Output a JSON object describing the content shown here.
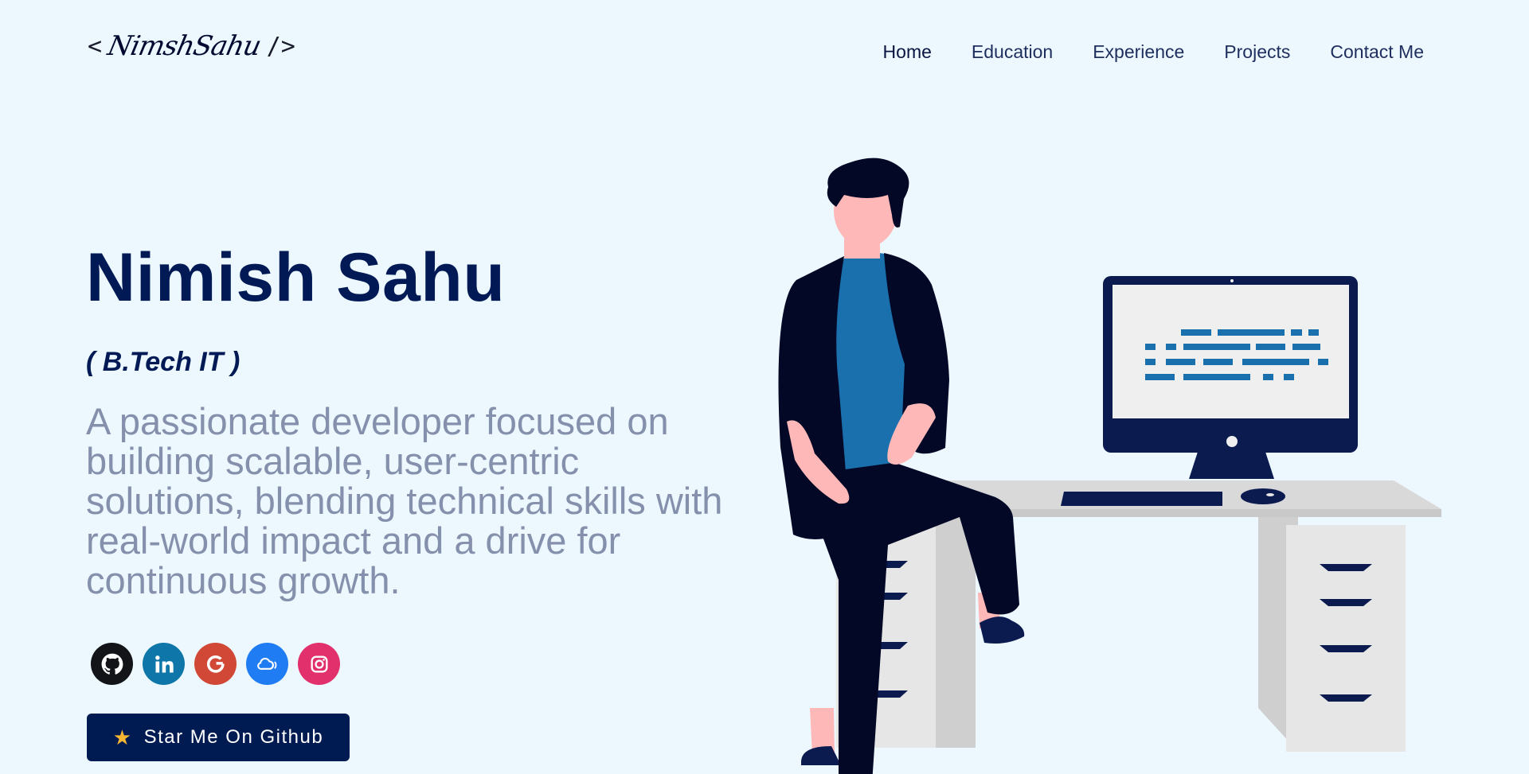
{
  "header": {
    "logo": {
      "open_bracket": "<",
      "signature": "NimshSahu",
      "close_bracket": "/>"
    },
    "nav": [
      {
        "label": "Home",
        "active": true
      },
      {
        "label": "Education"
      },
      {
        "label": "Experience"
      },
      {
        "label": "Projects"
      },
      {
        "label": "Contact Me"
      }
    ]
  },
  "hero": {
    "name": "Nimish Sahu",
    "degree": "( B.Tech IT )",
    "description": "A passionate developer focused on building scalable, user-centric solutions, blending technical skills with real-world impact and a drive for continuous growth.",
    "socials": [
      {
        "icon": "github-icon",
        "color": "#131418"
      },
      {
        "icon": "linkedin-icon",
        "color": "#0e76a8"
      },
      {
        "icon": "google-icon",
        "color": "#d14836"
      },
      {
        "icon": "cloud-icon",
        "color": "#1f7cf2"
      },
      {
        "icon": "instagram-icon",
        "color": "#e1306c"
      }
    ],
    "star_button": {
      "icon": "star-icon",
      "label": "Star Me On Github"
    }
  },
  "colors": {
    "background": "#ecf8fe",
    "primary": "#001b52",
    "muted_text": "#8590ad",
    "illustration_blue": "#1a6fad"
  }
}
